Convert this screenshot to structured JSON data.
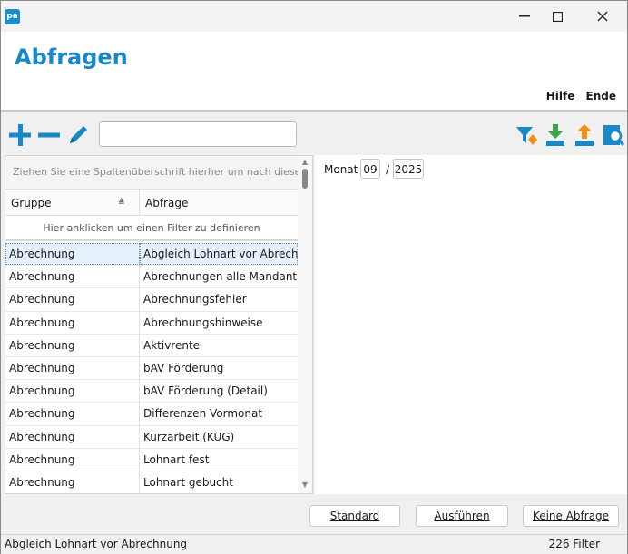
{
  "app": {
    "icon_text": "pa"
  },
  "window": {
    "minimize": "—",
    "maximize": "☐",
    "close": "✕"
  },
  "header": {
    "title": "Abfragen",
    "menu": {
      "help": "Hilfe",
      "end": "Ende"
    }
  },
  "toolbar": {
    "search_value": "",
    "icons": [
      "add-icon",
      "remove-icon",
      "edit-pencil-icon",
      "filter-icon",
      "download-icon",
      "upload-icon",
      "search-preview-icon"
    ]
  },
  "grid": {
    "group_hint": "Ziehen Sie eine Spaltenüberschrift hierher um nach diese",
    "columns": [
      "Gruppe",
      "Abfrage"
    ],
    "filter_hint": "Hier anklicken um einen Filter zu definieren",
    "rows": [
      [
        "Abrechnung",
        "Abgleich Lohnart vor Abrechr"
      ],
      [
        "Abrechnung",
        "Abrechnungen alle Mandante"
      ],
      [
        "Abrechnung",
        "Abrechnungsfehler"
      ],
      [
        "Abrechnung",
        "Abrechnungshinweise"
      ],
      [
        "Abrechnung",
        "Aktivrente"
      ],
      [
        "Abrechnung",
        "bAV Förderung"
      ],
      [
        "Abrechnung",
        "bAV Förderung (Detail)"
      ],
      [
        "Abrechnung",
        "Differenzen Vormonat"
      ],
      [
        "Abrechnung",
        "Kurzarbeit (KUG)"
      ],
      [
        "Abrechnung",
        "Lohnart fest"
      ],
      [
        "Abrechnung",
        "Lohnart gebucht"
      ]
    ],
    "selected_index": 0
  },
  "params": {
    "month_label": "Monat",
    "month": "09",
    "separator": "/",
    "year": "2025"
  },
  "buttons": {
    "standard": "Standard",
    "run": "Ausführen",
    "none": "Keine Abfrage"
  },
  "status": {
    "left": "Abgleich Lohnart vor Abrechnung",
    "right": "226 Filter"
  },
  "colors": {
    "accent": "#1b87c4",
    "selection": "#e6f0fa",
    "icon_orange": "#f28c1a",
    "icon_green": "#3aa54a"
  }
}
